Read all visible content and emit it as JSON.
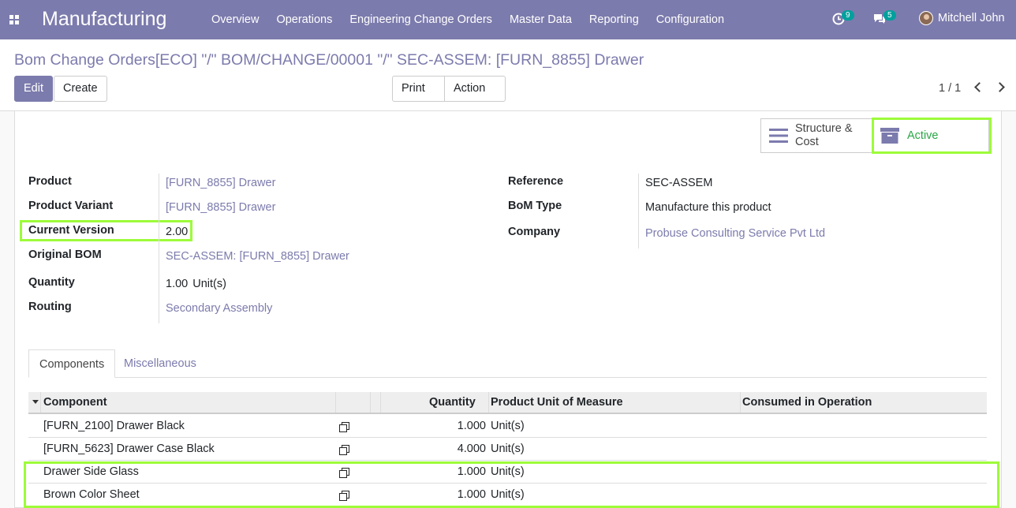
{
  "nav": {
    "app_title": "Manufacturing",
    "menu": [
      "Overview",
      "Operations",
      "Engineering Change Orders",
      "Master Data",
      "Reporting",
      "Configuration"
    ],
    "activity_count": "9",
    "message_count": "5",
    "user_name": "Mitchell John"
  },
  "control": {
    "breadcrumb": "Bom Change Orders[ECO] \"/\" BOM/CHANGE/00001 \"/\" SEC-ASSEM: [FURN_8855] Drawer",
    "edit_label": "Edit",
    "create_label": "Create",
    "print_label": "Print",
    "action_label": "Action",
    "pager": "1 / 1"
  },
  "smart_buttons": {
    "structure_line1": "Structure &",
    "structure_line2": "Cost",
    "active_label": "Active"
  },
  "fields_left": [
    {
      "label": "Product",
      "value": "[FURN_8855] Drawer",
      "link": true
    },
    {
      "label": "Product Variant",
      "value": "[FURN_8855] Drawer",
      "link": true
    },
    {
      "label": "Current Version",
      "value": "2.00",
      "link": false
    },
    {
      "label": "Original BOM",
      "value": "SEC-ASSEM: [FURN_8855] Drawer",
      "link": true
    },
    {
      "label": "Quantity",
      "value": "1.00",
      "unit": "Unit(s)",
      "link": false
    },
    {
      "label": "Routing",
      "value": "Secondary Assembly",
      "link": true
    }
  ],
  "fields_right": [
    {
      "label": "Reference",
      "value": "SEC-ASSEM",
      "link": false
    },
    {
      "label": "BoM Type",
      "value": "Manufacture this product",
      "link": false
    },
    {
      "label": "Company",
      "value": "Probuse Consulting Service Pvt Ltd",
      "link": true
    }
  ],
  "tabs": [
    "Components",
    "Miscellaneous"
  ],
  "table": {
    "headers": [
      "Component",
      "Quantity",
      "Product Unit of Measure",
      "Consumed in Operation"
    ],
    "rows": [
      {
        "component": "[FURN_2100] Drawer Black",
        "quantity": "1.000",
        "uom": "Unit(s)"
      },
      {
        "component": "[FURN_5623] Drawer Case Black",
        "quantity": "4.000",
        "uom": "Unit(s)"
      },
      {
        "component": "Drawer Side Glass",
        "quantity": "1.000",
        "uom": "Unit(s)"
      },
      {
        "component": "Brown Color Sheet",
        "quantity": "1.000",
        "uom": "Unit(s)"
      }
    ]
  },
  "colors": {
    "brand": "#7c7bad",
    "highlight": "#9dfb3a",
    "badge": "#00a09d",
    "active_text": "#28a745"
  }
}
